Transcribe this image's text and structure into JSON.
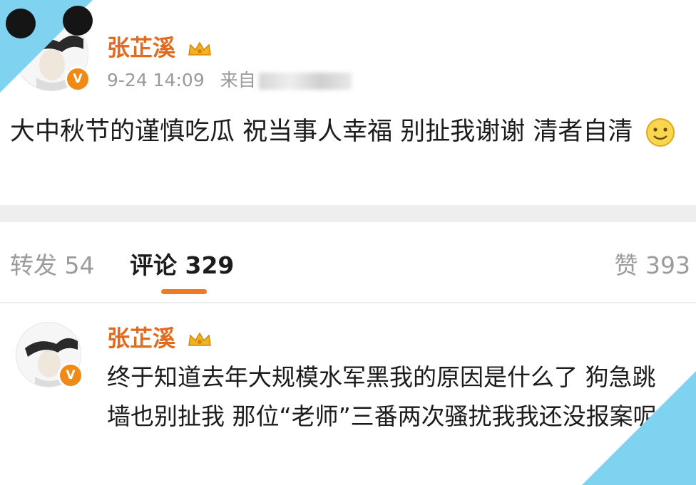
{
  "post": {
    "author": "张芷溪",
    "date": "9-24 14:09",
    "source_prefix": "来自",
    "text": "大中秋节的谨慎吃瓜 祝当事人幸福 别扯我谢谢 清者自清"
  },
  "tabs": {
    "repost": "转发 54",
    "comment": "评论 329",
    "like": "赞 393"
  },
  "comment": {
    "author": "张芷溪",
    "text": "终于知道去年大规模水军黑我的原因是什么了 狗急跳墙也别扯我 那位“老师”三番两次骚扰我我还没报案呢"
  },
  "colors": {
    "username": "#e3691d",
    "accent_indicator": "#f07a22",
    "verified_badge": "#f08a16",
    "corner_decoration": "#7fd3f0"
  },
  "icons": [
    "verified-badge-icon",
    "vip-crown-icon",
    "smile-emoji-icon"
  ]
}
